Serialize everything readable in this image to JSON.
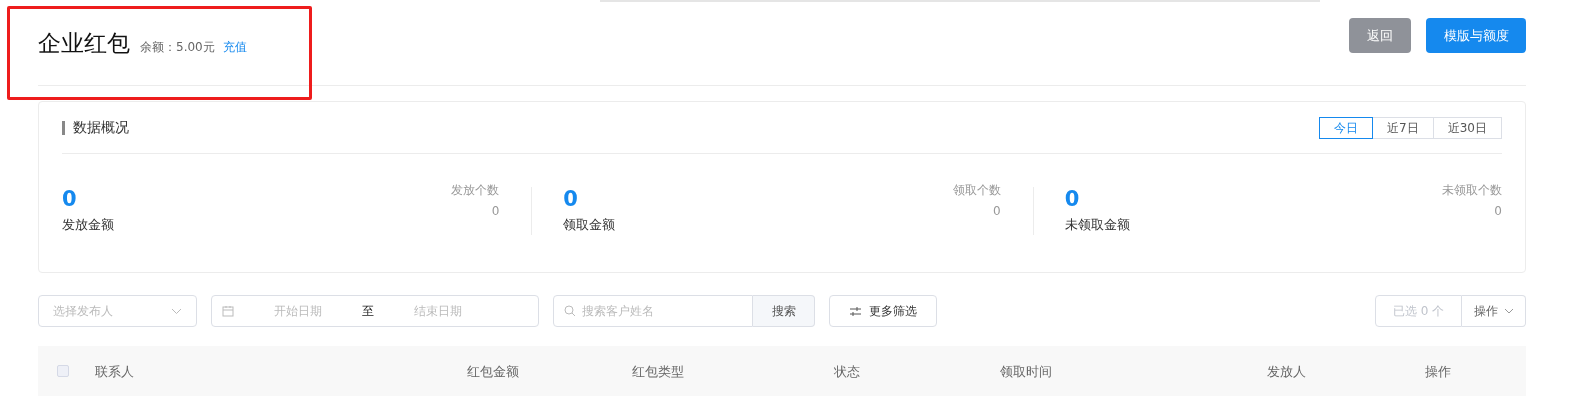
{
  "header": {
    "title": "企业红包",
    "balance": "余额：5.00元",
    "recharge_link": "充值",
    "highlighted": true,
    "buttons": [
      {
        "label": "返回",
        "kind": "secondary"
      },
      {
        "label": "模版与额度",
        "kind": "primary"
      }
    ]
  },
  "overview": {
    "title": "数据概况",
    "ranges": [
      {
        "label": "今日",
        "selected": true
      },
      {
        "label": "近7日",
        "selected": false
      },
      {
        "label": "近30日",
        "selected": false
      }
    ],
    "stats": [
      {
        "value": "0",
        "label": "发放金额",
        "sub_label": "发放个数",
        "sub_value": "0"
      },
      {
        "value": "0",
        "label": "领取金额",
        "sub_label": "领取个数",
        "sub_value": "0"
      },
      {
        "value": "0",
        "label": "未领取金额",
        "sub_label": "未领取个数",
        "sub_value": "0"
      }
    ]
  },
  "filters": {
    "publisher": {
      "placeholder": "选择发布人"
    },
    "date_range": {
      "start_placeholder": "开始日期",
      "separator": "至",
      "end_placeholder": "结束日期"
    },
    "search": {
      "placeholder": "搜索客户姓名",
      "button": "搜索"
    },
    "more_filters": "更多筛选",
    "selected_count": "已选 0 个",
    "actions": "操作"
  },
  "table": {
    "select_all_checked": false,
    "columns": [
      "联系人",
      "红包金额",
      "红包类型",
      "状态",
      "领取时间",
      "发放人",
      "操作"
    ]
  }
}
